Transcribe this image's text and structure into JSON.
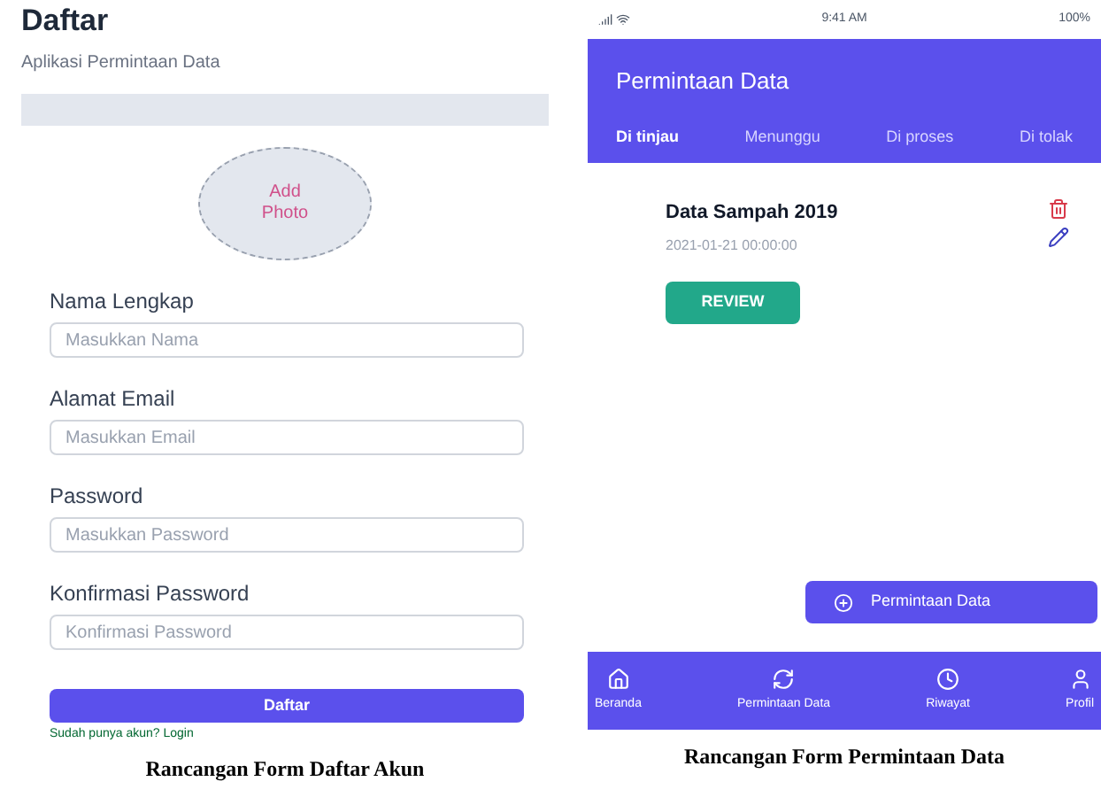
{
  "register_form": {
    "title": "Daftar",
    "subtitle": "Aplikasi Permintaan Data",
    "photo_button": "Add Photo",
    "fields": [
      {
        "label": "Nama Lengkap",
        "placeholder": "Masukkan Nama"
      },
      {
        "label": "Alamat Email",
        "placeholder": "Masukkan Email"
      },
      {
        "label": "Password",
        "placeholder": "Masukkan Password"
      },
      {
        "label": "Konfirmasi Password",
        "placeholder": "Konfirmasi Password"
      }
    ],
    "submit_button": "Daftar",
    "login_hint": "Sudah punya akun? Login",
    "caption": "Rancangan Form Daftar Akun"
  },
  "request_screen": {
    "status_bar": {
      "time": "9:41 AM",
      "battery": "100%"
    },
    "title": "Permintaan Data",
    "tabs": [
      {
        "label": "Di tinjau",
        "selected": true
      },
      {
        "label": "Menunggu",
        "selected": false
      },
      {
        "label": "Di proses",
        "selected": false
      },
      {
        "label": "Di tolak",
        "selected": false
      }
    ],
    "items": [
      {
        "title": "Data Sampah 2019",
        "date": "2021-01-21 00:00:00",
        "action": "REVIEW"
      }
    ],
    "fab": "Permintaan Data",
    "bottom_nav": [
      {
        "label": "Beranda",
        "kind": "home"
      },
      {
        "label": "Permintaan Data",
        "kind": "sync"
      },
      {
        "label": "Riwayat",
        "kind": "history"
      },
      {
        "label": "Profil",
        "kind": "profile"
      }
    ],
    "caption": "Rancangan Form Permintaan Data"
  }
}
